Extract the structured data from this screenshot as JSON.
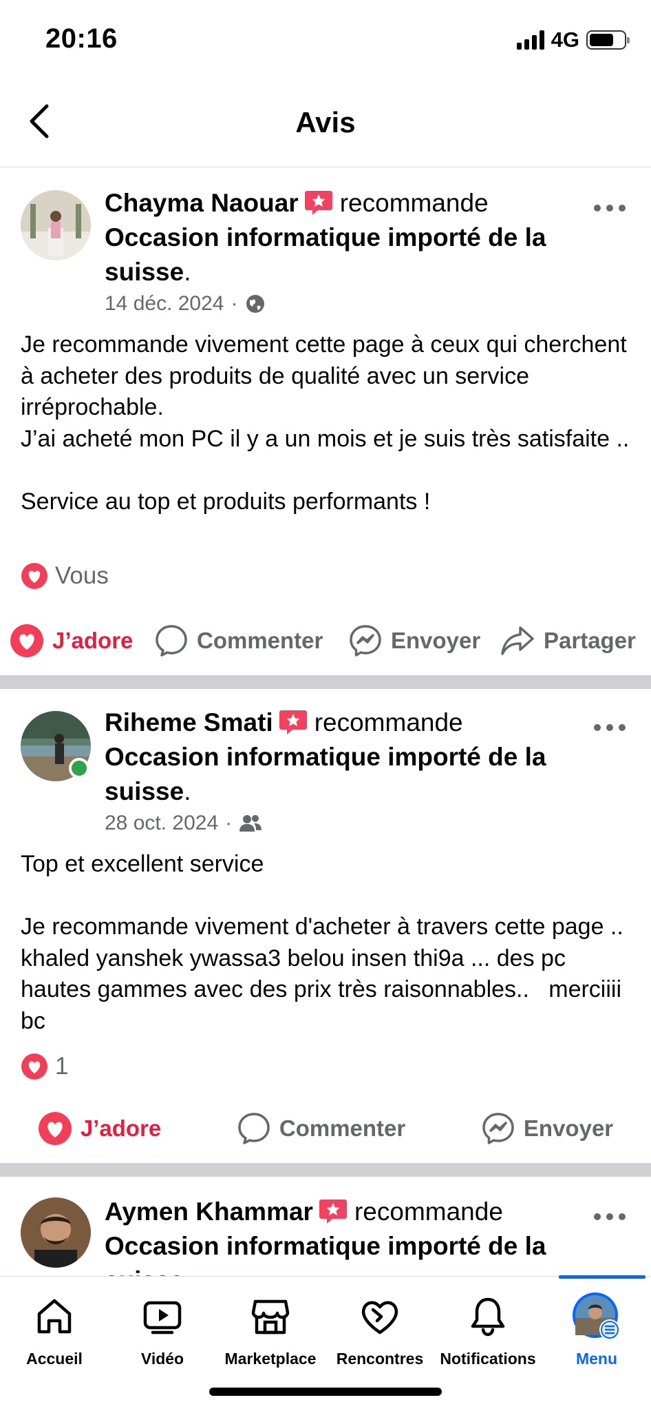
{
  "status_bar": {
    "time": "20:16",
    "network": "4G"
  },
  "header": {
    "title": "Avis"
  },
  "posts": [
    {
      "author": "Chayma Naouar",
      "action": "recommande",
      "page": "Occasion informatique importé de la suisse",
      "date": "14 déc. 2024",
      "audience_icon": "globe-icon",
      "text": "Je recommande vivement cette page à ceux qui cherchent à acheter des produits de qualité avec un service irréprochable.\nJ’ai acheté mon PC il y a un mois et je suis très satisfaite ..\n\nService au top et produits performants !",
      "reactions": "Vous",
      "actions": [
        "J’adore",
        "Commenter",
        "Envoyer",
        "Partager"
      ]
    },
    {
      "author": "Riheme Smati",
      "action": "recommande",
      "page": "Occasion informatique importé de la suisse",
      "date": "28 oct. 2024",
      "audience_icon": "friends-icon",
      "text": "Top et excellent service\n\nJe recommande vivement d'acheter à travers cette page .. khaled yanshek ywassa3 belou insen thi9a ... des pc hautes gammes avec des prix très raisonnables..   merciiii bc",
      "reactions": "1",
      "actions": [
        "J’adore",
        "Commenter",
        "Envoyer"
      ]
    },
    {
      "author": "Aymen Khammar",
      "action": "recommande",
      "page": "Occasion informatique importé de la suisse"
    }
  ],
  "bottom_nav": [
    {
      "label": "Accueil",
      "icon": "home-icon"
    },
    {
      "label": "Vidéo",
      "icon": "video-icon"
    },
    {
      "label": "Marketplace",
      "icon": "marketplace-icon"
    },
    {
      "label": "Rencontres",
      "icon": "dating-heart-icon"
    },
    {
      "label": "Notifications",
      "icon": "bell-icon"
    },
    {
      "label": "Menu",
      "icon": "profile-avatar-menu-icon",
      "active": true
    }
  ],
  "colors": {
    "accent": "#0866ff",
    "love": "#e41e3f",
    "separator": "#ced0d4",
    "secondary_text": "#65676b"
  }
}
